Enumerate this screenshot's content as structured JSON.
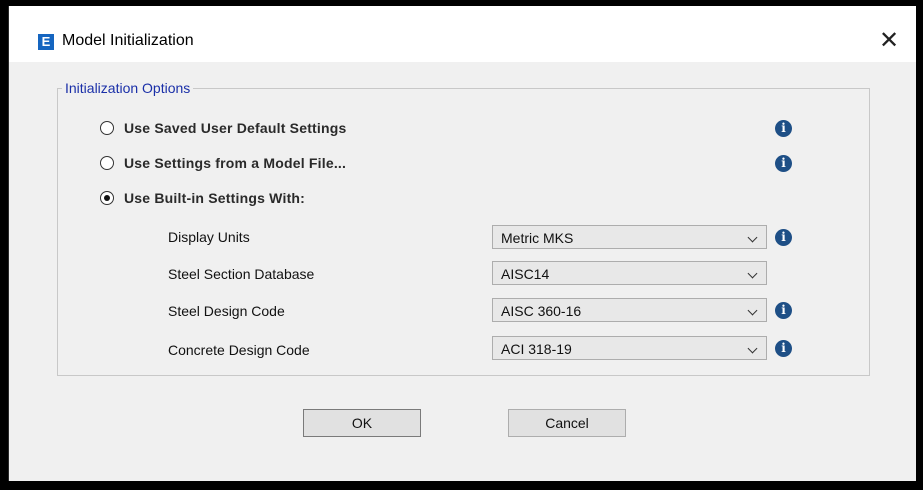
{
  "window": {
    "title": "Model Initialization",
    "app_icon_letter": "E",
    "app_icon_name": "etabs-app-icon",
    "close_glyph": "✕"
  },
  "group": {
    "label": "Initialization Options"
  },
  "options": [
    {
      "label": "Use Saved User Default Settings",
      "checked": false
    },
    {
      "label": "Use Settings from a Model File...",
      "checked": false
    },
    {
      "label": "Use Built-in Settings With:",
      "checked": true
    }
  ],
  "fields": [
    {
      "label": "Display Units",
      "value": "Metric MKS",
      "has_info": true
    },
    {
      "label": "Steel Section Database",
      "value": "AISC14",
      "has_info": false
    },
    {
      "label": "Steel Design Code",
      "value": "AISC 360-16",
      "has_info": true
    },
    {
      "label": "Concrete Design Code",
      "value": "ACI 318-19",
      "has_info": true
    }
  ],
  "info_glyph": "i",
  "buttons": {
    "ok": "OK",
    "cancel": "Cancel"
  },
  "colors": {
    "accent_blue": "#1565c0",
    "group_label": "#1a2fa8",
    "info_icon": "#1e4f86",
    "dialog_bg": "#f0f0f0"
  }
}
